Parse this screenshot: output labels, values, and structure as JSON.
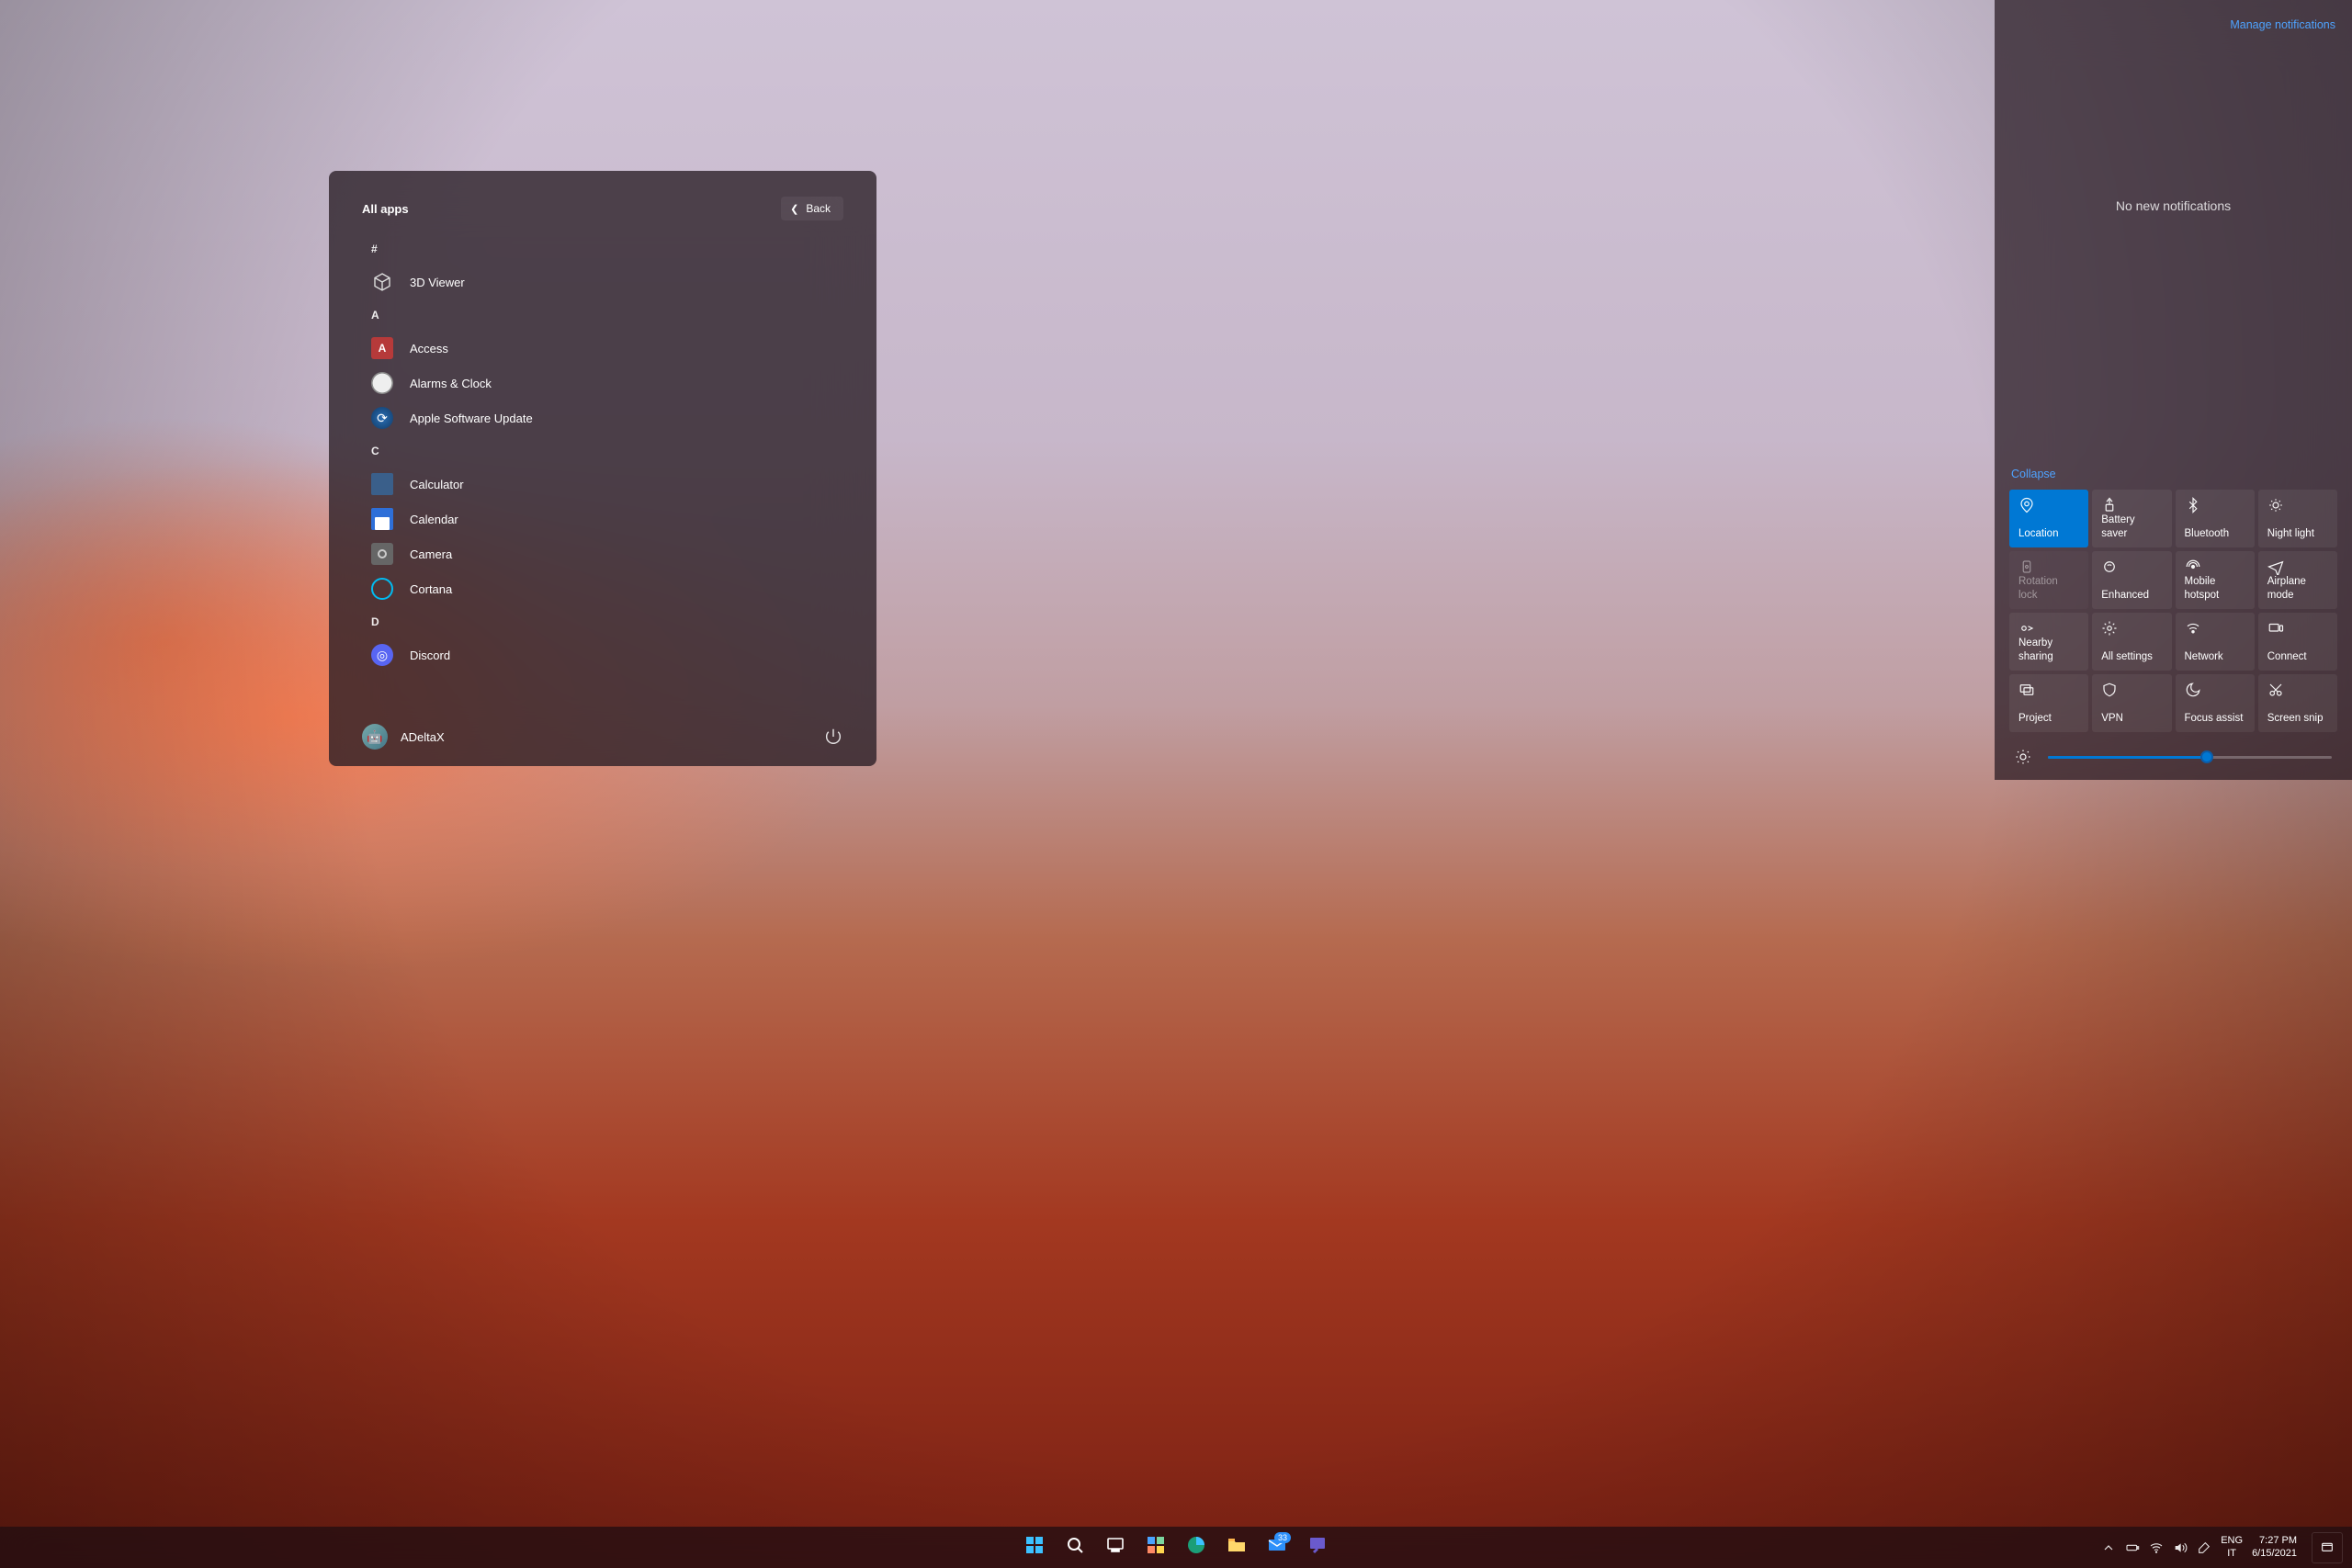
{
  "startMenu": {
    "title": "All apps",
    "backLabel": "Back",
    "groups": [
      {
        "letter": "#",
        "apps": [
          {
            "id": "3dviewer",
            "label": "3D Viewer",
            "icon": "cube"
          }
        ]
      },
      {
        "letter": "A",
        "apps": [
          {
            "id": "access",
            "label": "Access",
            "icon": "access"
          },
          {
            "id": "alarms",
            "label": "Alarms & Clock",
            "icon": "clock"
          },
          {
            "id": "appleswu",
            "label": "Apple Software Update",
            "icon": "apple"
          }
        ]
      },
      {
        "letter": "C",
        "apps": [
          {
            "id": "calculator",
            "label": "Calculator",
            "icon": "calc"
          },
          {
            "id": "calendar",
            "label": "Calendar",
            "icon": "cal"
          },
          {
            "id": "camera",
            "label": "Camera",
            "icon": "cam"
          },
          {
            "id": "cortana",
            "label": "Cortana",
            "icon": "cort"
          }
        ]
      },
      {
        "letter": "D",
        "apps": [
          {
            "id": "discord",
            "label": "Discord",
            "icon": "disc"
          }
        ]
      }
    ],
    "user": "ADeltaX"
  },
  "actionCenter": {
    "manageLink": "Manage notifications",
    "emptyText": "No new notifications",
    "collapseLabel": "Collapse",
    "tiles": [
      {
        "id": "location",
        "label": "Location",
        "icon": "location",
        "active": true
      },
      {
        "id": "battery",
        "label": "Battery saver",
        "icon": "battery"
      },
      {
        "id": "bluetooth",
        "label": "Bluetooth",
        "icon": "bluetooth"
      },
      {
        "id": "nightlight",
        "label": "Night light",
        "icon": "nightlight"
      },
      {
        "id": "rotation",
        "label": "Rotation lock",
        "icon": "rotation",
        "disabled": true
      },
      {
        "id": "enhanced",
        "label": "Enhanced",
        "icon": "enhanced"
      },
      {
        "id": "hotspot",
        "label": "Mobile hotspot",
        "icon": "hotspot"
      },
      {
        "id": "airplane",
        "label": "Airplane mode",
        "icon": "airplane"
      },
      {
        "id": "nearby",
        "label": "Nearby sharing",
        "icon": "nearby"
      },
      {
        "id": "settings",
        "label": "All settings",
        "icon": "settings"
      },
      {
        "id": "network",
        "label": "Network",
        "icon": "network"
      },
      {
        "id": "connect",
        "label": "Connect",
        "icon": "connect"
      },
      {
        "id": "project",
        "label": "Project",
        "icon": "project"
      },
      {
        "id": "vpn",
        "label": "VPN",
        "icon": "vpn"
      },
      {
        "id": "focus",
        "label": "Focus assist",
        "icon": "focus"
      },
      {
        "id": "snip",
        "label": "Screen snip",
        "icon": "snip"
      }
    ],
    "brightnessPercent": 56
  },
  "taskbar": {
    "apps": [
      {
        "id": "start",
        "icon": "start"
      },
      {
        "id": "search",
        "icon": "search"
      },
      {
        "id": "taskview",
        "icon": "taskview"
      },
      {
        "id": "widgets",
        "icon": "widgets"
      },
      {
        "id": "edge",
        "icon": "edge"
      },
      {
        "id": "explorer",
        "icon": "explorer"
      },
      {
        "id": "mail",
        "icon": "mail",
        "badge": "33"
      },
      {
        "id": "feedback",
        "icon": "feedback"
      }
    ],
    "tray": {
      "lang1": "ENG",
      "lang2": "IT",
      "time": "7:27 PM",
      "date": "6/15/2021"
    }
  }
}
